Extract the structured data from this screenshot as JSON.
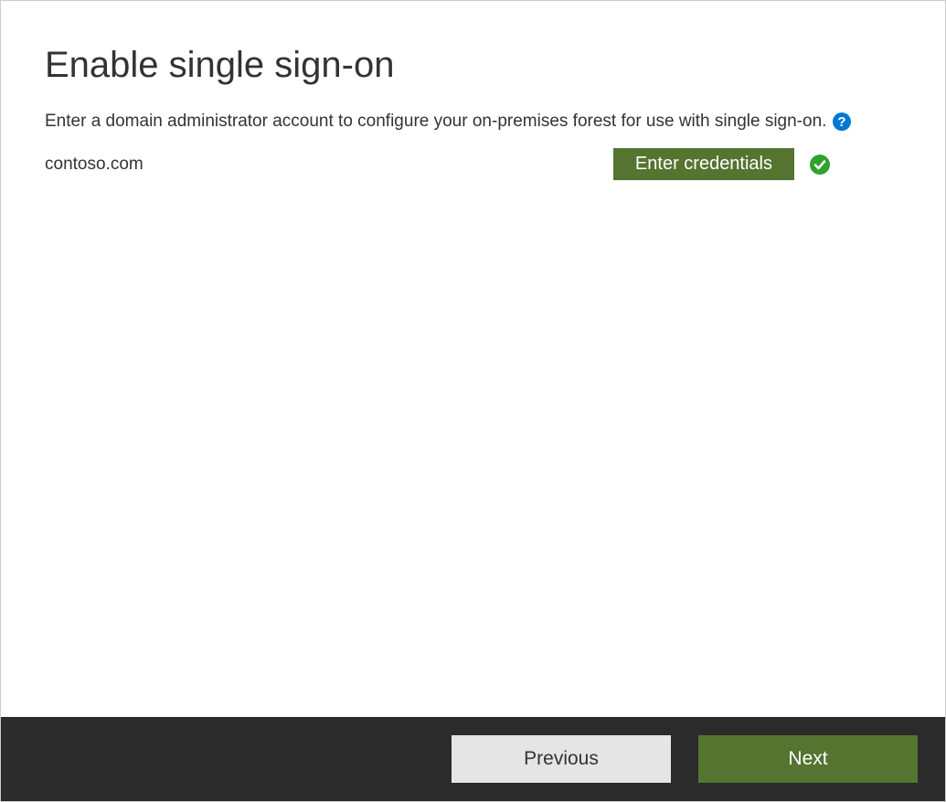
{
  "page": {
    "title": "Enable single sign-on",
    "instruction": "Enter a domain administrator account to configure your on-premises forest for use with single sign-on."
  },
  "domain": {
    "name": "contoso.com",
    "enter_credentials_label": "Enter credentials"
  },
  "footer": {
    "previous_label": "Previous",
    "next_label": "Next"
  },
  "colors": {
    "primary_green": "#547430",
    "footer_bg": "#2b2b2b",
    "help_blue": "#0078d4",
    "success_green": "#2fa12f"
  }
}
